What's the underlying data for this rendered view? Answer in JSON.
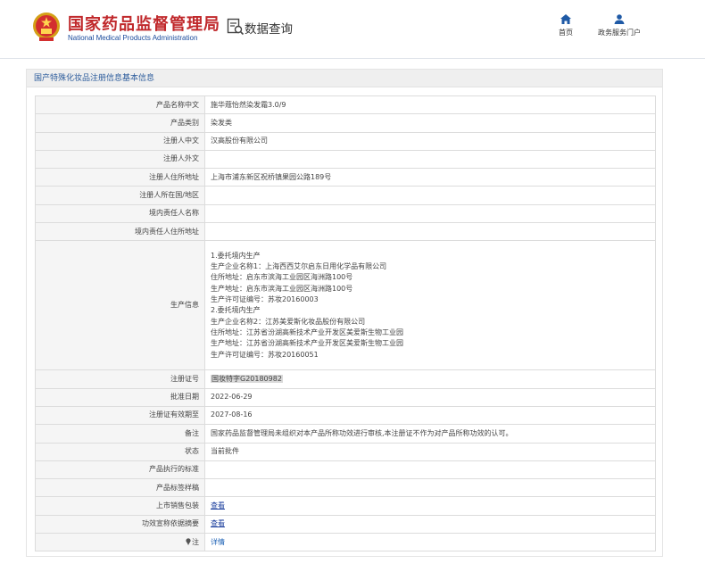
{
  "header": {
    "site_title": "国家药品监督管理局",
    "site_subtitle": "National Medical Products Administration",
    "query_title": "数据查询",
    "nav": [
      {
        "label": "首页",
        "icon": "home-icon"
      },
      {
        "label": "政务服务门户",
        "icon": "user-icon"
      }
    ],
    "colors": {
      "brand_red": "#c0282b",
      "brand_blue": "#1a4b9c",
      "nav_blue": "#1f5aa6"
    }
  },
  "panel": {
    "title": "国产特殊化妆品注册信息基本信息",
    "rows": [
      {
        "label": "产品名称中文",
        "value": "施华蔻怡然染发霜3.0/9"
      },
      {
        "label": "产品类别",
        "value": "染发类"
      },
      {
        "label": "注册人中文",
        "value": "汉高股份有限公司"
      },
      {
        "label": "注册人外文",
        "value": ""
      },
      {
        "label": "注册人住所地址",
        "value": "上海市浦东新区祝桥镇果园公路189号"
      },
      {
        "label": "注册人所在国/地区",
        "value": ""
      },
      {
        "label": "境内责任人名称",
        "value": ""
      },
      {
        "label": "境内责任人住所地址",
        "value": ""
      }
    ],
    "production": {
      "label": "生产信息",
      "lines": [
        "1.委托境内生产",
        "生产企业名称1：上海西西艾尔启东日用化学品有限公司",
        "住所地址：启东市滨海工业园区海洲路100号",
        "生产地址：启东市滨海工业园区海洲路100号",
        "生产许可证编号：苏妆20160003",
        "2.委托境内生产",
        "生产企业名称2：江苏美爱斯化妆品股份有限公司",
        "住所地址：江苏省汾湖高新技术产业开发区美爱斯生物工业园",
        "生产地址：江苏省汾湖高新技术产业开发区美爱斯生物工业园",
        "生产许可证编号：苏妆20160051"
      ]
    },
    "rows2": [
      {
        "label": "注册证号",
        "value": "国妆特字G20180982",
        "highlight": true
      },
      {
        "label": "批准日期",
        "value": "2022-06-29"
      },
      {
        "label": "注册证有效期至",
        "value": "2027-08-16"
      },
      {
        "label": "备注",
        "value": "国家药品监督管理局未组织对本产品所称功效进行审核,本注册证不作为对产品所称功效的认可。"
      },
      {
        "label": "状态",
        "value": "当前批件"
      },
      {
        "label": "产品执行的标准",
        "value": ""
      },
      {
        "label": "产品标签样稿",
        "value": ""
      },
      {
        "label": "上市销售包装",
        "value": "查看",
        "link": true
      },
      {
        "label": "功效宣称依据摘要",
        "value": "查看",
        "link": true
      },
      {
        "label": "注",
        "value": "详情",
        "link": true,
        "icon": "pin-icon"
      }
    ]
  }
}
